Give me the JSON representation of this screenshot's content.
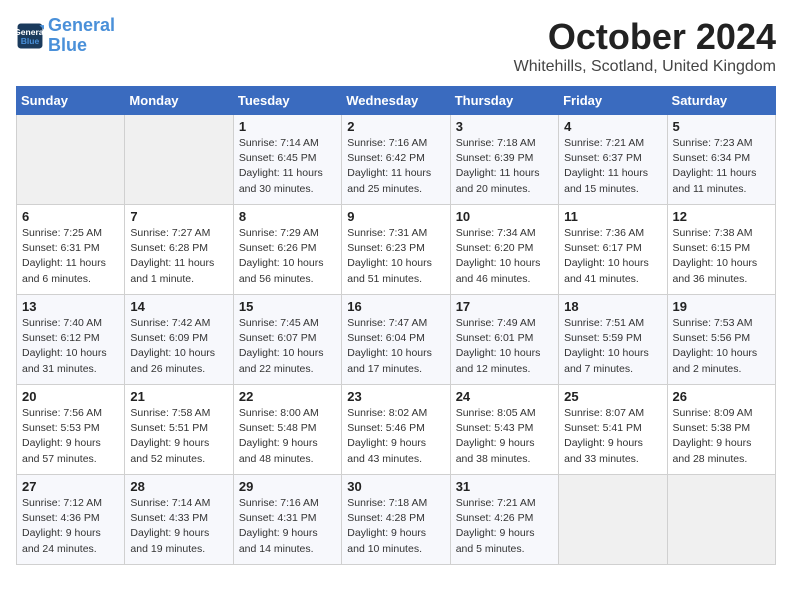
{
  "logo": {
    "line1": "General",
    "line2": "Blue"
  },
  "title": "October 2024",
  "location": "Whitehills, Scotland, United Kingdom",
  "columns": [
    "Sunday",
    "Monday",
    "Tuesday",
    "Wednesday",
    "Thursday",
    "Friday",
    "Saturday"
  ],
  "weeks": [
    [
      {
        "day": "",
        "info": ""
      },
      {
        "day": "",
        "info": ""
      },
      {
        "day": "1",
        "info": "Sunrise: 7:14 AM\nSunset: 6:45 PM\nDaylight: 11 hours\nand 30 minutes."
      },
      {
        "day": "2",
        "info": "Sunrise: 7:16 AM\nSunset: 6:42 PM\nDaylight: 11 hours\nand 25 minutes."
      },
      {
        "day": "3",
        "info": "Sunrise: 7:18 AM\nSunset: 6:39 PM\nDaylight: 11 hours\nand 20 minutes."
      },
      {
        "day": "4",
        "info": "Sunrise: 7:21 AM\nSunset: 6:37 PM\nDaylight: 11 hours\nand 15 minutes."
      },
      {
        "day": "5",
        "info": "Sunrise: 7:23 AM\nSunset: 6:34 PM\nDaylight: 11 hours\nand 11 minutes."
      }
    ],
    [
      {
        "day": "6",
        "info": "Sunrise: 7:25 AM\nSunset: 6:31 PM\nDaylight: 11 hours\nand 6 minutes."
      },
      {
        "day": "7",
        "info": "Sunrise: 7:27 AM\nSunset: 6:28 PM\nDaylight: 11 hours\nand 1 minute."
      },
      {
        "day": "8",
        "info": "Sunrise: 7:29 AM\nSunset: 6:26 PM\nDaylight: 10 hours\nand 56 minutes."
      },
      {
        "day": "9",
        "info": "Sunrise: 7:31 AM\nSunset: 6:23 PM\nDaylight: 10 hours\nand 51 minutes."
      },
      {
        "day": "10",
        "info": "Sunrise: 7:34 AM\nSunset: 6:20 PM\nDaylight: 10 hours\nand 46 minutes."
      },
      {
        "day": "11",
        "info": "Sunrise: 7:36 AM\nSunset: 6:17 PM\nDaylight: 10 hours\nand 41 minutes."
      },
      {
        "day": "12",
        "info": "Sunrise: 7:38 AM\nSunset: 6:15 PM\nDaylight: 10 hours\nand 36 minutes."
      }
    ],
    [
      {
        "day": "13",
        "info": "Sunrise: 7:40 AM\nSunset: 6:12 PM\nDaylight: 10 hours\nand 31 minutes."
      },
      {
        "day": "14",
        "info": "Sunrise: 7:42 AM\nSunset: 6:09 PM\nDaylight: 10 hours\nand 26 minutes."
      },
      {
        "day": "15",
        "info": "Sunrise: 7:45 AM\nSunset: 6:07 PM\nDaylight: 10 hours\nand 22 minutes."
      },
      {
        "day": "16",
        "info": "Sunrise: 7:47 AM\nSunset: 6:04 PM\nDaylight: 10 hours\nand 17 minutes."
      },
      {
        "day": "17",
        "info": "Sunrise: 7:49 AM\nSunset: 6:01 PM\nDaylight: 10 hours\nand 12 minutes."
      },
      {
        "day": "18",
        "info": "Sunrise: 7:51 AM\nSunset: 5:59 PM\nDaylight: 10 hours\nand 7 minutes."
      },
      {
        "day": "19",
        "info": "Sunrise: 7:53 AM\nSunset: 5:56 PM\nDaylight: 10 hours\nand 2 minutes."
      }
    ],
    [
      {
        "day": "20",
        "info": "Sunrise: 7:56 AM\nSunset: 5:53 PM\nDaylight: 9 hours\nand 57 minutes."
      },
      {
        "day": "21",
        "info": "Sunrise: 7:58 AM\nSunset: 5:51 PM\nDaylight: 9 hours\nand 52 minutes."
      },
      {
        "day": "22",
        "info": "Sunrise: 8:00 AM\nSunset: 5:48 PM\nDaylight: 9 hours\nand 48 minutes."
      },
      {
        "day": "23",
        "info": "Sunrise: 8:02 AM\nSunset: 5:46 PM\nDaylight: 9 hours\nand 43 minutes."
      },
      {
        "day": "24",
        "info": "Sunrise: 8:05 AM\nSunset: 5:43 PM\nDaylight: 9 hours\nand 38 minutes."
      },
      {
        "day": "25",
        "info": "Sunrise: 8:07 AM\nSunset: 5:41 PM\nDaylight: 9 hours\nand 33 minutes."
      },
      {
        "day": "26",
        "info": "Sunrise: 8:09 AM\nSunset: 5:38 PM\nDaylight: 9 hours\nand 28 minutes."
      }
    ],
    [
      {
        "day": "27",
        "info": "Sunrise: 7:12 AM\nSunset: 4:36 PM\nDaylight: 9 hours\nand 24 minutes."
      },
      {
        "day": "28",
        "info": "Sunrise: 7:14 AM\nSunset: 4:33 PM\nDaylight: 9 hours\nand 19 minutes."
      },
      {
        "day": "29",
        "info": "Sunrise: 7:16 AM\nSunset: 4:31 PM\nDaylight: 9 hours\nand 14 minutes."
      },
      {
        "day": "30",
        "info": "Sunrise: 7:18 AM\nSunset: 4:28 PM\nDaylight: 9 hours\nand 10 minutes."
      },
      {
        "day": "31",
        "info": "Sunrise: 7:21 AM\nSunset: 4:26 PM\nDaylight: 9 hours\nand 5 minutes."
      },
      {
        "day": "",
        "info": ""
      },
      {
        "day": "",
        "info": ""
      }
    ]
  ]
}
